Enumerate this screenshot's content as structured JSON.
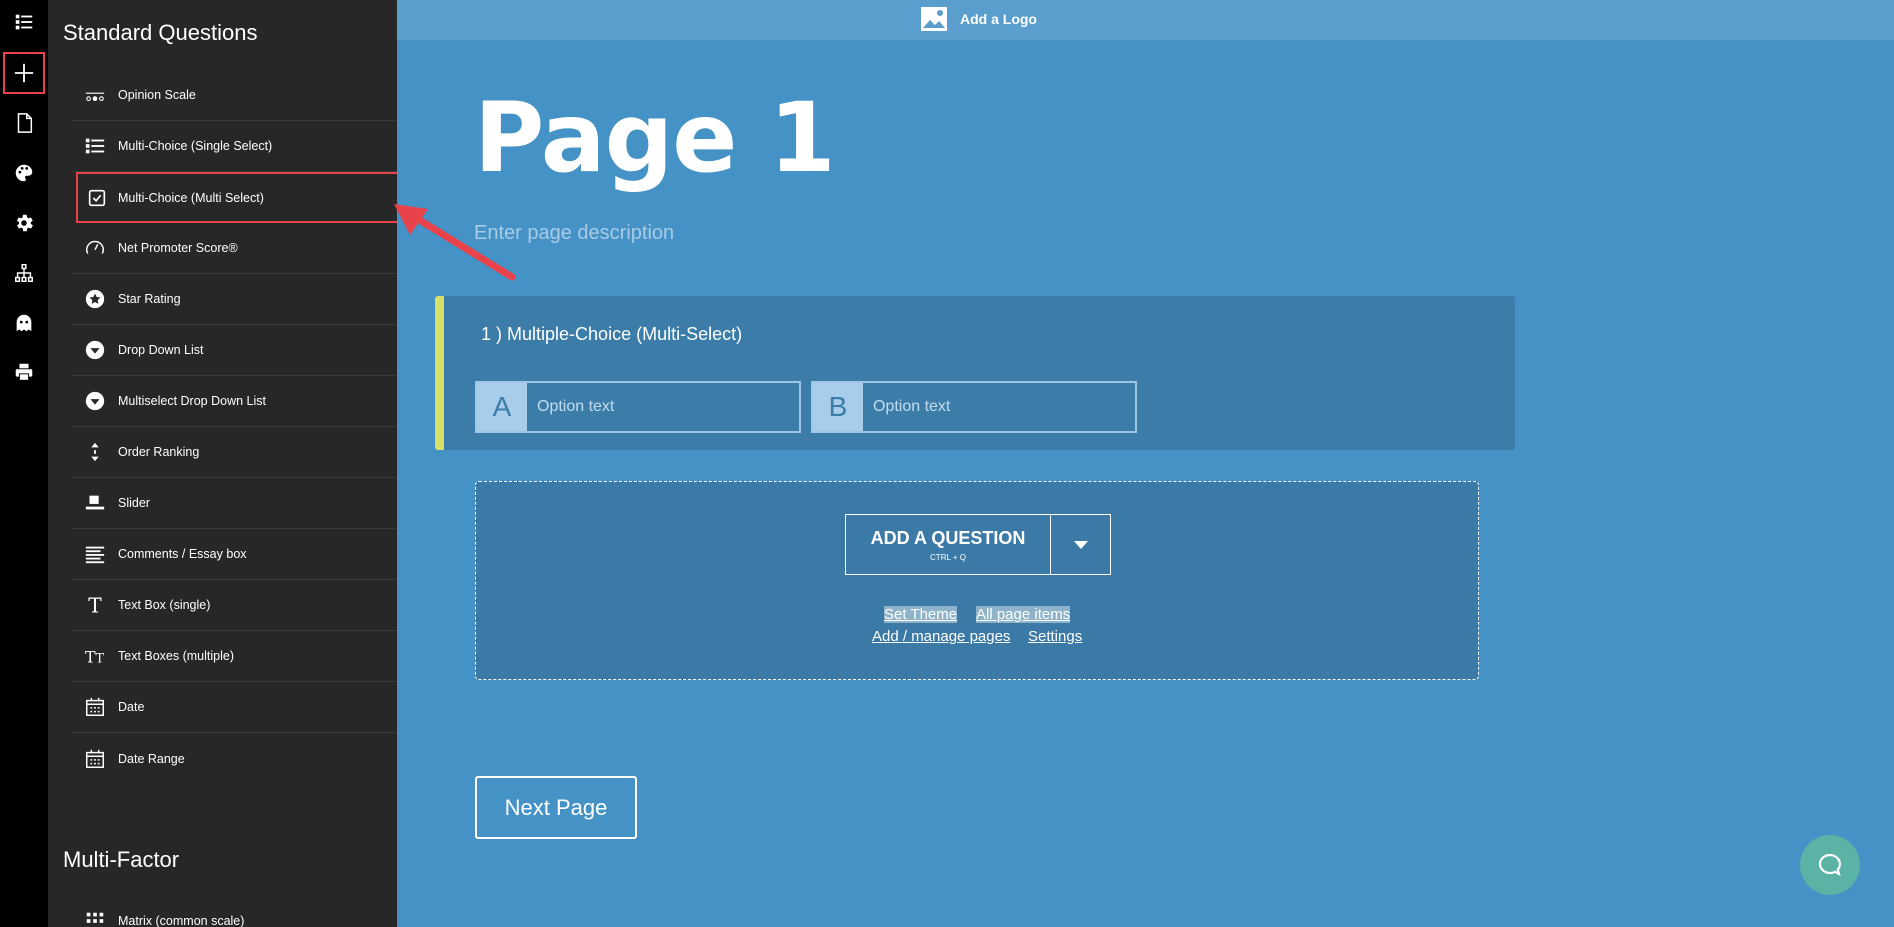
{
  "sidebar": {
    "standard_heading": "Standard Questions",
    "multifactor_heading": "Multi-Factor",
    "items": [
      {
        "label": "Opinion Scale",
        "icon": "opinion-scale-icon"
      },
      {
        "label": "Multi-Choice (Single Select)",
        "icon": "list-icon"
      },
      {
        "label": "Multi-Choice (Multi Select)",
        "icon": "checkbox-icon"
      },
      {
        "label": "Net Promoter Score®",
        "icon": "gauge-icon"
      },
      {
        "label": "Star Rating",
        "icon": "star-icon"
      },
      {
        "label": "Drop Down List",
        "icon": "dropdown-icon"
      },
      {
        "label": "Multiselect Drop Down List",
        "icon": "dropdown-icon"
      },
      {
        "label": "Order Ranking",
        "icon": "sort-icon"
      },
      {
        "label": "Slider",
        "icon": "slider-icon"
      },
      {
        "label": "Comments / Essay box",
        "icon": "text-lines-icon"
      },
      {
        "label": "Text Box (single)",
        "icon": "text-t-icon"
      },
      {
        "label": "Text Boxes (multiple)",
        "icon": "text-tt-icon"
      },
      {
        "label": "Date",
        "icon": "calendar-icon"
      },
      {
        "label": "Date Range",
        "icon": "calendar-icon"
      }
    ],
    "matrix_item": {
      "label": "Matrix (common scale)",
      "icon": "grid-icon"
    }
  },
  "header": {
    "add_logo": "Add a Logo"
  },
  "page": {
    "title": "Page 1",
    "description_placeholder": "Enter page description"
  },
  "question": {
    "number": "1 )",
    "title": "Multiple-Choice (Multi-Select)",
    "options": [
      {
        "letter": "A",
        "text": "Option text"
      },
      {
        "letter": "B",
        "text": "Option text"
      }
    ]
  },
  "add_zone": {
    "add_label": "ADD A QUESTION",
    "shortcut": "CTRL + Q",
    "links": {
      "set_theme": "Set Theme",
      "all_page_items": "All page items",
      "manage_pages": "Add / manage pages",
      "settings": "Settings"
    }
  },
  "next_page": "Next Page",
  "colors": {
    "background": "#4592c6",
    "sidebar": "#272727",
    "highlight": "#e8424b",
    "accent_bar": "#d9e06a",
    "chat": "#5bb3a5"
  }
}
